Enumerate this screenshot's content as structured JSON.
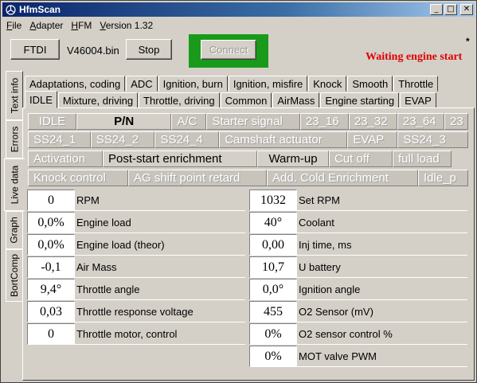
{
  "window": {
    "title": "HfmScan"
  },
  "menu": [
    "File",
    "Adapter",
    "HFM",
    "Version 1.32"
  ],
  "toolbar": {
    "ftdi_label": "FTDI",
    "filename": "V46004.bin",
    "stop_label": "Stop",
    "connect_label": "Connect",
    "star": "*",
    "status_text": "Waiting engine start"
  },
  "side_tabs": [
    "Text info",
    "Errors",
    "Live data",
    "Graph",
    "BortComp"
  ],
  "tabs_row1": [
    "Adaptations, coding",
    "ADC",
    "Ignition, burn",
    "Ignition, misfire",
    "Knock",
    "Smooth",
    "Throttle"
  ],
  "tabs_row2": [
    "IDLE",
    "Mixture, driving",
    "Throttle, driving",
    "Common",
    "AirMass",
    "Engine starting",
    "EVAP"
  ],
  "signal_rows": [
    [
      {
        "label": "IDLE",
        "on": false
      },
      {
        "label": "P/N",
        "on": true,
        "bold": true
      },
      {
        "label": "A/C",
        "on": false
      },
      {
        "label": "Starter signal",
        "on": false
      },
      {
        "label": "23_16",
        "on": false
      },
      {
        "label": "23_32",
        "on": false
      },
      {
        "label": "23_64",
        "on": false
      },
      {
        "label": "23",
        "on": false
      }
    ],
    [
      {
        "label": "SS24_1",
        "on": false
      },
      {
        "label": "SS24_2",
        "on": false
      },
      {
        "label": "SS24_4",
        "on": false
      },
      {
        "label": "Camshaft actuator",
        "on": false
      },
      {
        "label": "EVAP",
        "on": false
      },
      {
        "label": "SS24_3",
        "on": false
      }
    ],
    [
      {
        "label": "Activation",
        "on": false
      },
      {
        "label": "Post-start enrichment",
        "on": true
      },
      {
        "label": "Warm-up",
        "on": true
      },
      {
        "label": "Cut off",
        "on": false
      },
      {
        "label": "full load",
        "on": false
      }
    ],
    [
      {
        "label": "Knock control",
        "on": false
      },
      {
        "label": "AG shift point retard",
        "on": false
      },
      {
        "label": "Add. Cold Enrichment",
        "on": false
      },
      {
        "label": "Idle_p",
        "on": false
      }
    ]
  ],
  "left_params": [
    {
      "value": "0",
      "label": "RPM"
    },
    {
      "value": "0,0%",
      "label": "Engine load"
    },
    {
      "value": "0,0%",
      "label": "Engine load (theor)"
    },
    {
      "value": "-0,1",
      "label": "Air Mass"
    },
    {
      "value": "9,4°",
      "label": "Throttle angle"
    },
    {
      "value": "0,03",
      "label": "Throttle response voltage"
    },
    {
      "value": "0",
      "label": "Throttle motor, control"
    }
  ],
  "right_params": [
    {
      "value": "1032",
      "label": "Set RPM"
    },
    {
      "value": "40°",
      "label": "Coolant"
    },
    {
      "value": "0,00",
      "label": "Inj time, ms"
    },
    {
      "value": "10,7",
      "label": "U battery"
    },
    {
      "value": "0,0°",
      "label": "Ignition angle"
    },
    {
      "value": "455",
      "label": "O2 Sensor (mV)"
    },
    {
      "value": "0%",
      "label": "O2 sensor control %"
    },
    {
      "value": "0%",
      "label": "MOT valve PWM"
    }
  ]
}
